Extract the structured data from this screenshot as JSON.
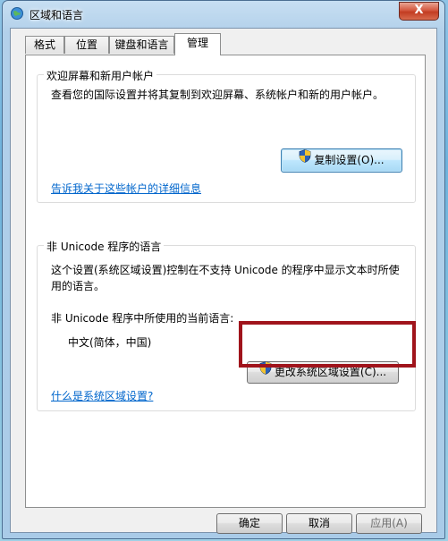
{
  "window": {
    "title": "区域和语言",
    "close_label": "X"
  },
  "tabs": [
    {
      "label": "格式",
      "active": false
    },
    {
      "label": "位置",
      "active": false
    },
    {
      "label": "键盘和语言",
      "active": false
    },
    {
      "label": "管理",
      "active": true
    }
  ],
  "welcome_group": {
    "title": "欢迎屏幕和新用户帐户",
    "description": "查看您的国际设置并将其复制到欢迎屏幕、系统帐户和新的用户帐户。",
    "copy_button": "复制设置(O)...",
    "link": "告诉我关于这些帐户的详细信息"
  },
  "unicode_group": {
    "title": "非 Unicode 程序的语言",
    "description_line1": "这个设置(系统区域设置)控制在不支持 Unicode 的程序中显示文本时所使",
    "description_line2": "用的语言。",
    "current_label": "非 Unicode 程序中所使用的当前语言:",
    "current_value": "中文(简体，中国)",
    "change_button": "更改系统区域设置(C)...",
    "link": "什么是系统区域设置?"
  },
  "footer": {
    "ok": "确定",
    "cancel": "取消",
    "apply": "应用(A)"
  },
  "colors": {
    "highlight": "#a0141c",
    "link": "#0066cc"
  }
}
